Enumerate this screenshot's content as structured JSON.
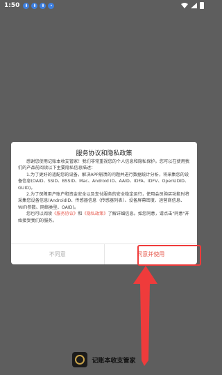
{
  "status_bar": {
    "time": "1:50",
    "notifications": [
      "notif-icon",
      "notif-icon",
      "notif-icon",
      "notif-icon"
    ],
    "icons": [
      "wifi-icon",
      "signal-icon",
      "battery-icon"
    ]
  },
  "dialog": {
    "title": "服务协议和隐私政策",
    "paragraph1": "感谢您使用记账本收支管家！我们非常重视您的个人信息和隐私保护。您可以在使用我们的产品前阅读以下主要隐私信息描述：",
    "paragraph2": "1.为了更好的适配您的设备，解决APP崩溃的问题并进行数据统计分析，将采集您的设备信息(OAID、SSID、BSSID、Mac、Android ID、AAID、IDFA、IDFV、OpenUDID、GUID)。",
    "paragraph3": "2.为了保障用户账户和资金安全以及支付服务的安全稳定运行，使用会员购买功能时将采集您设备信息(AndroidID、传感器信息（传感器列表）、设备屏幕密度、运营商信息、WIFI参数、网络类型、OAID)。",
    "paragraph4_prefix": "您也可以阅读",
    "link_service": "《服务协议》",
    "paragraph4_and": "和",
    "link_privacy": "《隐私政策》",
    "paragraph4_suffix": "了解详细信息。如您同意，请点击\"同意\"开始接受我们的服务。",
    "decline_label": "不同意",
    "agree_label": "同意并使用"
  },
  "brand": {
    "name": "记账本收支管家"
  },
  "colors": {
    "accent": "#e65a4e",
    "annotation": "#ef3b3b",
    "overlay": "#5e5e5e"
  }
}
